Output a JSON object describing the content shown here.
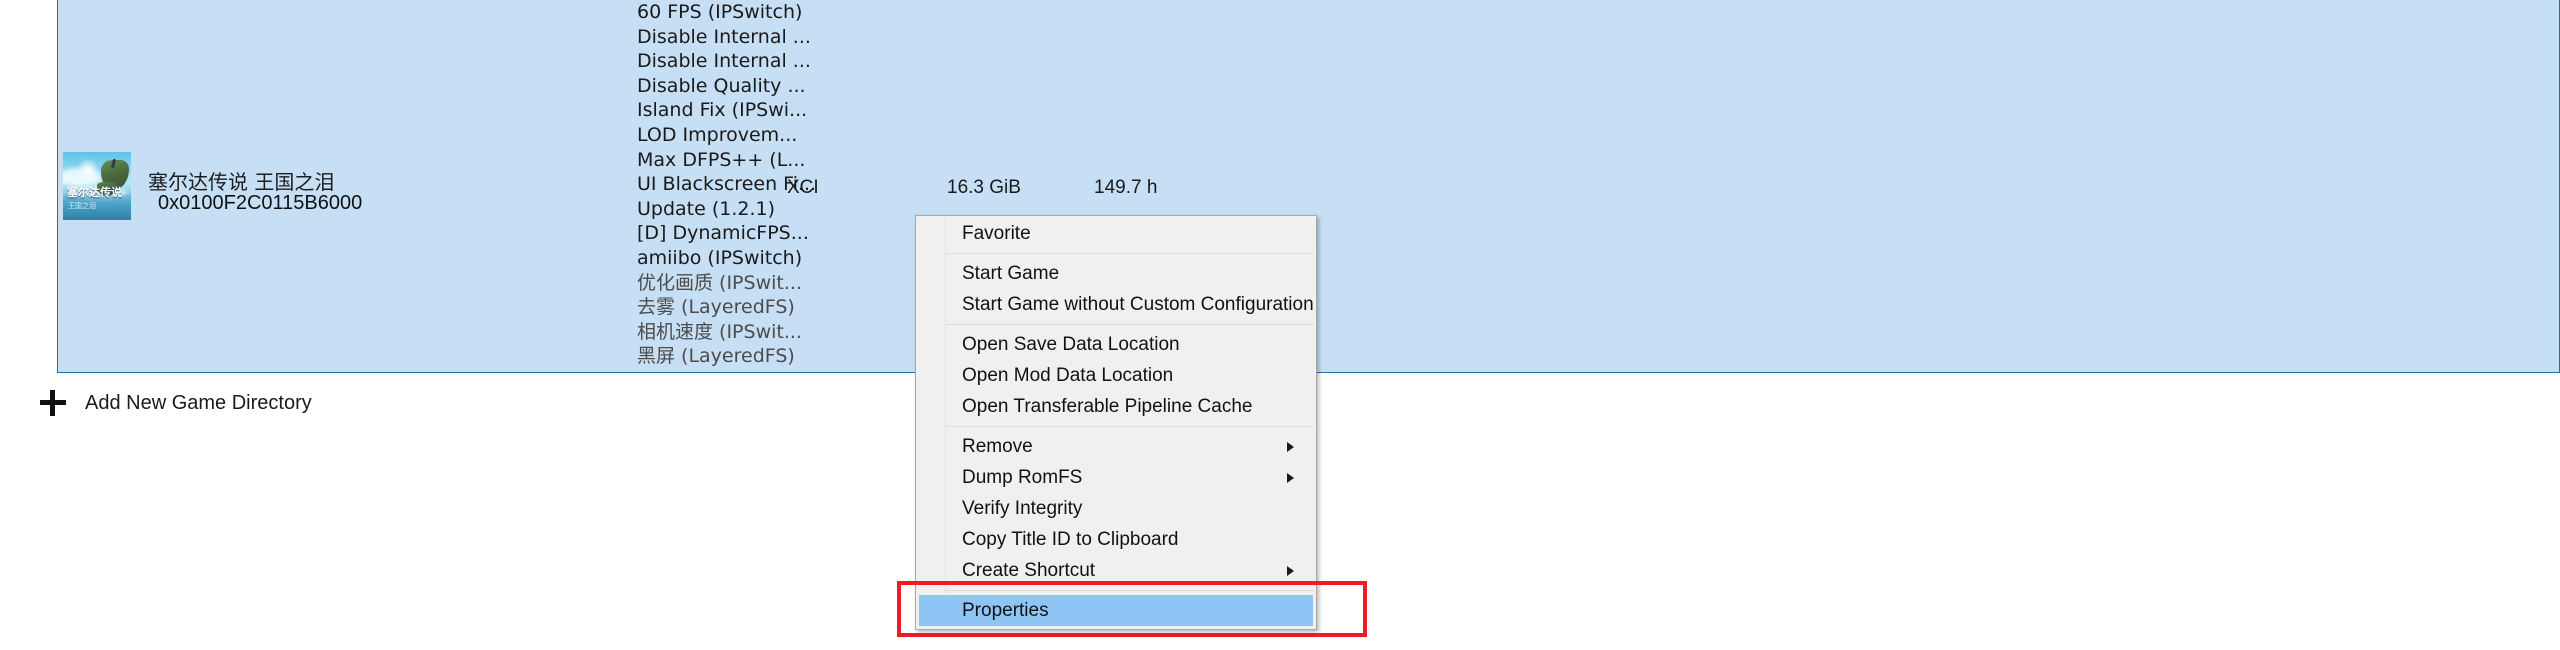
{
  "game_row": {
    "title": "塞尔达传说 王国之泪",
    "title_id": "0x0100F2C0115B6000",
    "file_format": "XCI",
    "file_size": "16.3 GiB",
    "time_played": "149.7 h",
    "thumbnail": {
      "name": "zelda-totk-cover-art",
      "overlay_title": "塞尔达传说",
      "overlay_subtitle": "王国之泪"
    },
    "mods": [
      "60 FPS (IPSwitch)",
      "Disable Internal ...",
      "Disable Internal ...",
      "Disable Quality ...",
      "Island Fix (IPSwi...",
      "LOD Improvem...",
      "Max DFPS++ (L...",
      "UI Blackscreen Fi...",
      "Update (1.2.1)",
      "[D] DynamicFPS...",
      "amiibo (IPSwitch)",
      "优化画质 (IPSwit...",
      "去雾 (LayeredFS)",
      "相机速度 (IPSwit...",
      "黑屏 (LayeredFS)"
    ]
  },
  "add_directory": {
    "label": "Add New Game Directory",
    "icon": "plus-icon"
  },
  "context_menu": {
    "items": [
      {
        "label": "Favorite",
        "type": "item",
        "submenu": false,
        "highlighted": false
      },
      {
        "label": "",
        "type": "separator",
        "submenu": false,
        "highlighted": false
      },
      {
        "label": "Start Game",
        "type": "item",
        "submenu": false,
        "highlighted": false
      },
      {
        "label": "Start Game without Custom Configuration",
        "type": "item",
        "submenu": false,
        "highlighted": false
      },
      {
        "label": "",
        "type": "separator",
        "submenu": false,
        "highlighted": false
      },
      {
        "label": "Open Save Data Location",
        "type": "item",
        "submenu": false,
        "highlighted": false
      },
      {
        "label": "Open Mod Data Location",
        "type": "item",
        "submenu": false,
        "highlighted": false
      },
      {
        "label": "Open Transferable Pipeline Cache",
        "type": "item",
        "submenu": false,
        "highlighted": false
      },
      {
        "label": "",
        "type": "separator",
        "submenu": false,
        "highlighted": false
      },
      {
        "label": "Remove",
        "type": "item",
        "submenu": true,
        "highlighted": false
      },
      {
        "label": "Dump RomFS",
        "type": "item",
        "submenu": true,
        "highlighted": false
      },
      {
        "label": "Verify Integrity",
        "type": "item",
        "submenu": false,
        "highlighted": false
      },
      {
        "label": "Copy Title ID to Clipboard",
        "type": "item",
        "submenu": false,
        "highlighted": false
      },
      {
        "label": "Create Shortcut",
        "type": "item",
        "submenu": true,
        "highlighted": false
      },
      {
        "label": "",
        "type": "separator",
        "submenu": false,
        "highlighted": false
      },
      {
        "label": "Properties",
        "type": "item",
        "submenu": false,
        "highlighted": true
      }
    ]
  },
  "annotation": {
    "name": "red-highlight-rectangle",
    "color": "#ee1b24",
    "targets": "Properties"
  },
  "colors": {
    "row_selection_bg": "#c6dff5",
    "row_selection_border": "#2a6ca8",
    "menu_bg": "#f0f0f0",
    "menu_border": "#a8a8a8",
    "menu_highlight": "#8fc5f5",
    "separator": "#dcdcdc",
    "annotation_red": "#ee1b24"
  }
}
